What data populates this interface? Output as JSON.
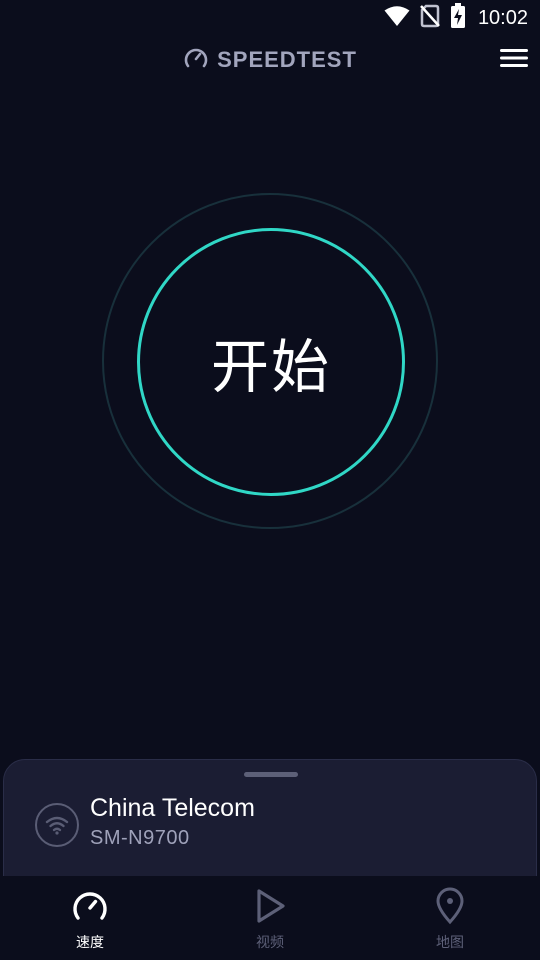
{
  "status_bar": {
    "time": "10:02",
    "icons": [
      "wifi-signal-icon",
      "no-sim-icon",
      "battery-charging-icon"
    ]
  },
  "header": {
    "brand": "SPEEDTEST",
    "brand_icon": "speedometer-icon",
    "menu_icon": "hamburger-menu-icon"
  },
  "start": {
    "label": "开始"
  },
  "connection": {
    "provider": "China Telecom",
    "device": "SM-N9700",
    "icon": "wifi-icon"
  },
  "nav": {
    "items": [
      {
        "label": "速度",
        "icon": "speedometer-icon",
        "active": true
      },
      {
        "label": "视频",
        "icon": "play-icon",
        "active": false
      },
      {
        "label": "地图",
        "icon": "map-pin-icon",
        "active": false
      }
    ]
  },
  "colors": {
    "background": "#0b0d1c",
    "accent": "#30d7c6",
    "sheet": "#1b1d33",
    "muted": "#5d6078"
  }
}
